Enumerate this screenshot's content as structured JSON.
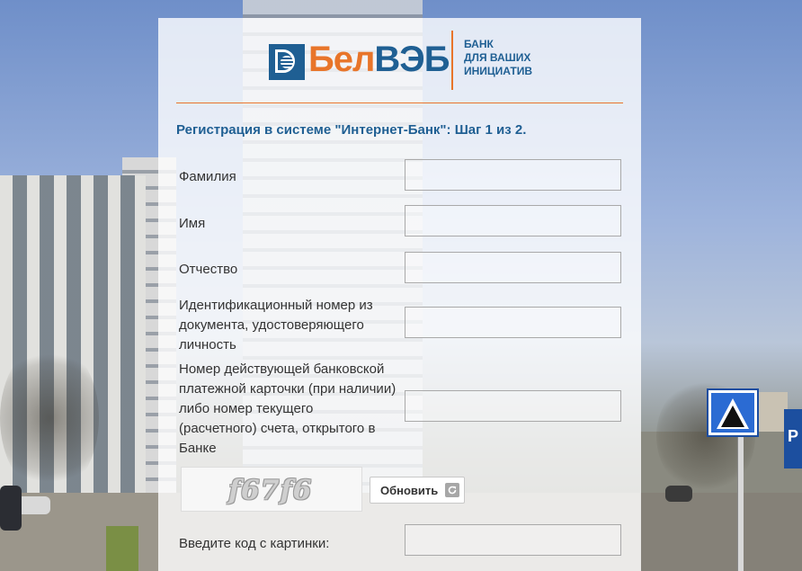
{
  "logo": {
    "brand_part1": "Бел",
    "brand_part2": "ВЭБ",
    "tagline_line1": "БАНК",
    "tagline_line2": "ДЛЯ ВАШИХ",
    "tagline_line3": "ИНИЦИАТИВ"
  },
  "colors": {
    "brand_blue": "#1f5f93",
    "brand_orange": "#e8752a"
  },
  "form": {
    "title": "Регистрация в системе \"Интернет-Банк\": Шаг 1 из 2.",
    "fields": [
      {
        "label": "Фамилия",
        "value": ""
      },
      {
        "label": "Имя",
        "value": ""
      },
      {
        "label": "Отчество",
        "value": ""
      },
      {
        "label_line1": "Идентификационный номер из",
        "label_line2": "документа, удостоверяющего",
        "label_line3": "личность",
        "value": ""
      },
      {
        "label_line1": "Номер действующей банковской",
        "label_line2": "платежной карточки (при наличии)",
        "label_line3": "либо номер текущего",
        "label_line4": "(расчетного) счета, открытого в",
        "label_line5": "Банке",
        "value": ""
      },
      {
        "label": "Введите код с картинки:",
        "value": ""
      }
    ],
    "captcha_text": "f67f6",
    "refresh_label": "Обновить",
    "refresh_icon": "refresh-icon"
  }
}
